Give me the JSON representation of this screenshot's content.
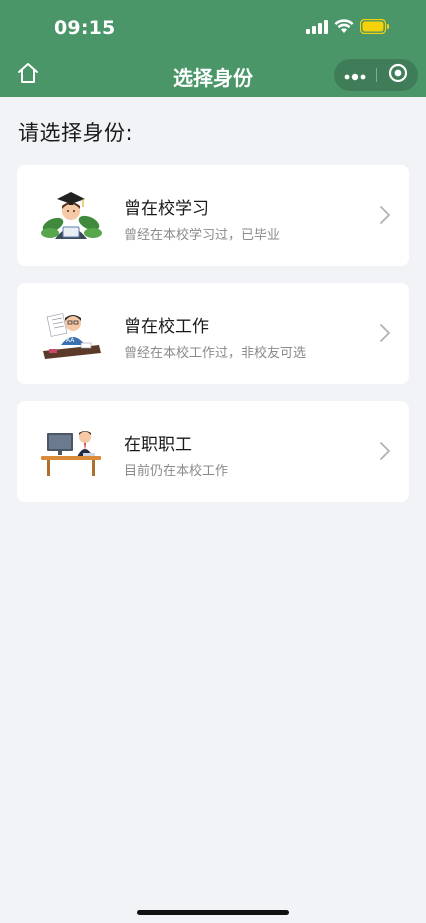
{
  "status_bar": {
    "time": "09:15"
  },
  "nav": {
    "title": "选择身份"
  },
  "heading": "请选择身份:",
  "options": [
    {
      "title": "曾在校学习",
      "subtitle": "曾经在本校学习过，已毕业",
      "icon": "graduate-illustration-icon"
    },
    {
      "title": "曾在校工作",
      "subtitle": "曾经在本校工作过，非校友可选",
      "icon": "former-staff-illustration-icon"
    },
    {
      "title": "在职职工",
      "subtitle": "目前仍在本校工作",
      "icon": "current-staff-illustration-icon"
    }
  ],
  "colors": {
    "brand_green": "#4a9668",
    "page_bg": "#f2f3f7",
    "battery": "#f5d20a"
  }
}
